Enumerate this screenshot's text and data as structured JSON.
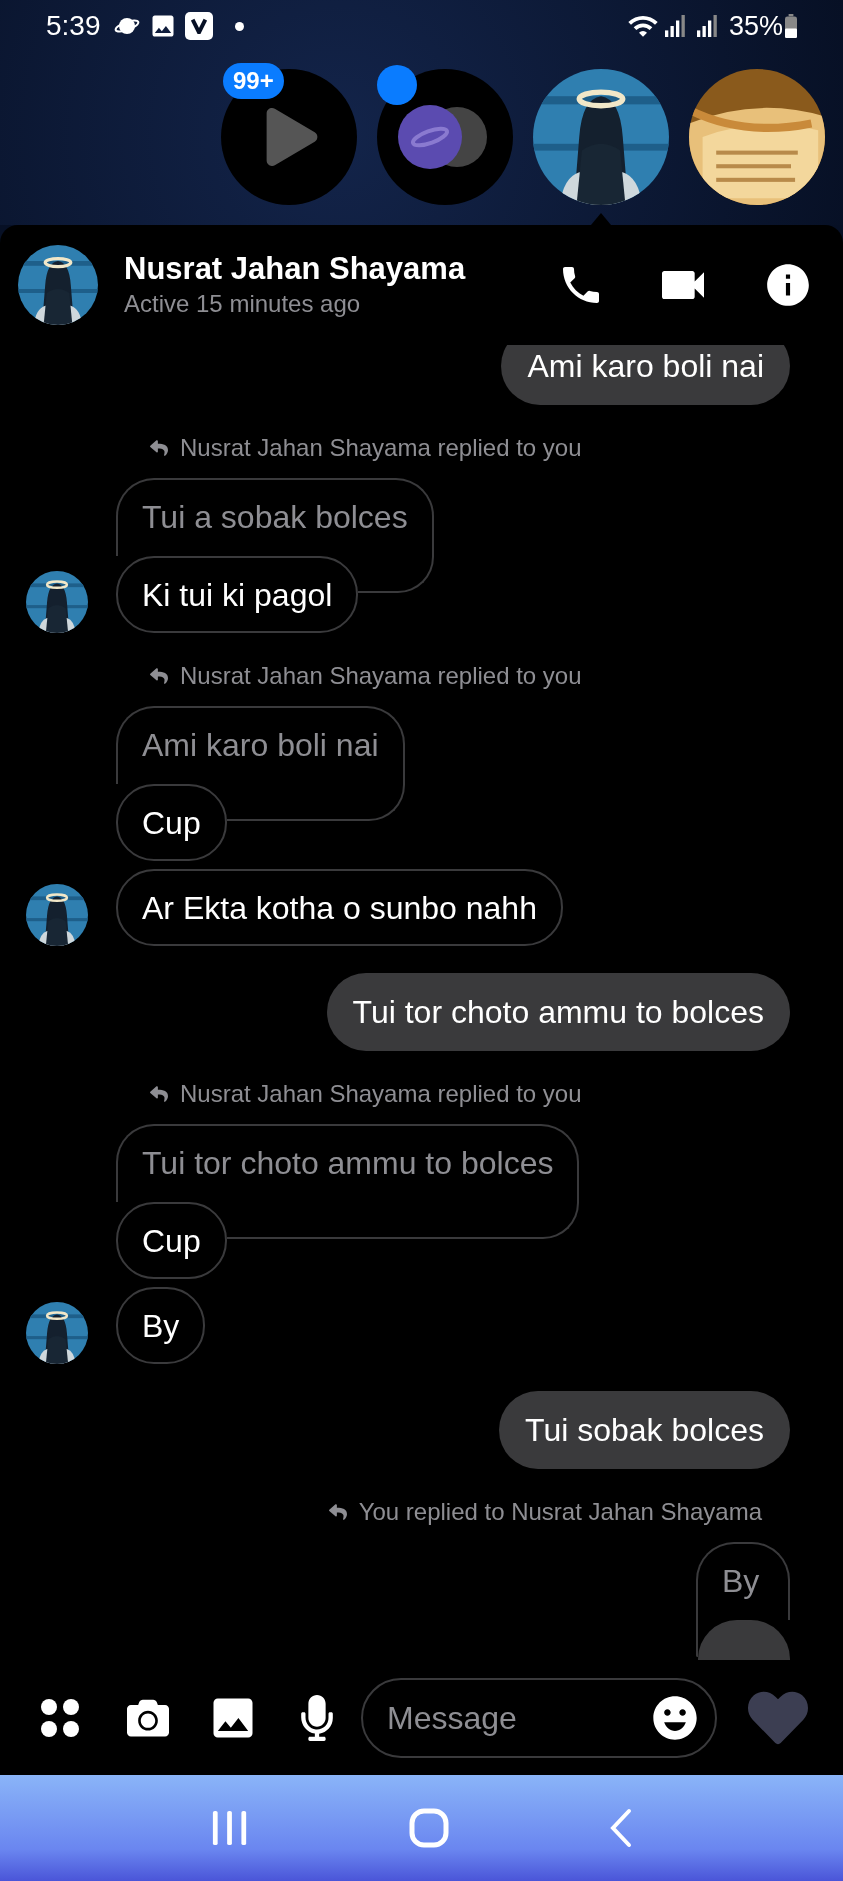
{
  "status_bar": {
    "time": "5:39",
    "battery": "35%"
  },
  "chat_heads": [
    {
      "kind": "video",
      "badge": "99+",
      "unread": false,
      "selected": false
    },
    {
      "kind": "app",
      "unread": true,
      "selected": false
    },
    {
      "kind": "person",
      "unread": false,
      "selected": true
    },
    {
      "kind": "book",
      "unread": false,
      "selected": false
    }
  ],
  "header": {
    "name": "Nusrat Jahan Shayama",
    "status": "Active 15 minutes ago"
  },
  "messages": [
    {
      "kind": "sent",
      "text": "Ami karo boli nai"
    },
    {
      "kind": "reply_label_in",
      "text": "Nusrat Jahan Shayama replied to you"
    },
    {
      "kind": "quote_in",
      "text": "Tui a sobak bolces"
    },
    {
      "kind": "received",
      "text": "Ki tui ki pagol",
      "avatar": true
    },
    {
      "kind": "reply_label_in",
      "text": "Nusrat Jahan Shayama replied to you"
    },
    {
      "kind": "quote_in",
      "text": "Ami karo boli nai"
    },
    {
      "kind": "received",
      "text": "Cup",
      "avatar": false
    },
    {
      "kind": "received",
      "text": "Ar Ekta kotha o sunbo nahh",
      "avatar": true
    },
    {
      "kind": "sent",
      "text": "Tui tor choto ammu to bolces"
    },
    {
      "kind": "reply_label_in",
      "text": "Nusrat Jahan Shayama replied to you"
    },
    {
      "kind": "quote_in",
      "text": "Tui tor choto ammu to bolces"
    },
    {
      "kind": "received",
      "text": "Cup",
      "avatar": false
    },
    {
      "kind": "received",
      "text": "By",
      "avatar": true
    },
    {
      "kind": "sent",
      "text": "Tui sobak bolces"
    },
    {
      "kind": "reply_label_out",
      "text": "You replied to Nusrat Jahan Shayama"
    },
    {
      "kind": "quote_out",
      "text": "By"
    },
    {
      "kind": "sent_cut"
    }
  ],
  "composer": {
    "placeholder": "Message"
  }
}
